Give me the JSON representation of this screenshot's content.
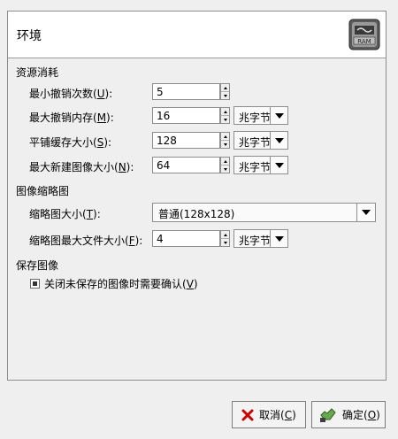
{
  "header": {
    "title": "环境",
    "icon": "ram-chip-icon"
  },
  "sections": {
    "resource": "资源消耗",
    "thumbnail": "图像缩略图",
    "save": "保存图像"
  },
  "rows": {
    "undo_min": {
      "label_pre": "最小撤销次数(",
      "mnemonic": "U",
      "label_post": "):",
      "value": "5"
    },
    "undo_mem": {
      "label_pre": "最大撤销内存(",
      "mnemonic": "M",
      "label_post": "):",
      "value": "16",
      "unit": "兆字节"
    },
    "tile_cache": {
      "label_pre": "平铺缓存大小(",
      "mnemonic": "S",
      "label_post": "):",
      "value": "128",
      "unit": "兆字节"
    },
    "max_new": {
      "label_pre": "最大新建图像大小(",
      "mnemonic": "N",
      "label_post": "):",
      "value": "64",
      "unit": "兆字节"
    },
    "thumb_size": {
      "label_pre": "缩略图大小(",
      "mnemonic": "T",
      "label_post": "):",
      "value": "普通(128x128)"
    },
    "thumb_file": {
      "label_pre": "缩略图最大文件大小(",
      "mnemonic": "F",
      "label_post": "):",
      "value": "4",
      "unit": "兆字节"
    }
  },
  "save_confirm": {
    "label_pre": "关闭未保存的图像时需要确认(",
    "mnemonic": "V",
    "label_post": ")",
    "checked": true
  },
  "buttons": {
    "cancel": {
      "label_pre": "取消(",
      "mnemonic": "C",
      "label_post": ")",
      "icon": "cancel-x-icon"
    },
    "ok": {
      "label_pre": "确定(",
      "mnemonic": "O",
      "label_post": ")",
      "icon": "ok-hand-icon"
    }
  }
}
